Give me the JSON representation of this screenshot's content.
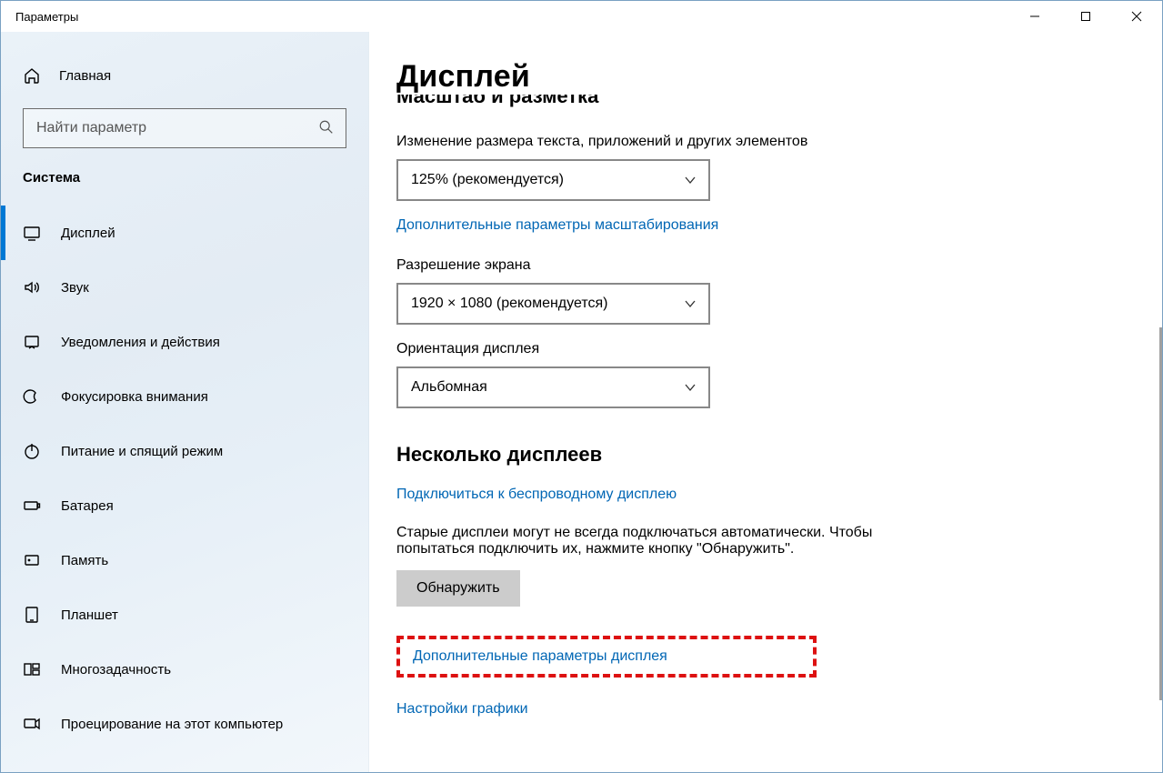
{
  "window": {
    "title": "Параметры"
  },
  "sidebar": {
    "home": "Главная",
    "search_placeholder": "Найти параметр",
    "category": "Система",
    "items": [
      {
        "label": "Дисплей",
        "active": true
      },
      {
        "label": "Звук",
        "active": false
      },
      {
        "label": "Уведомления и действия",
        "active": false
      },
      {
        "label": "Фокусировка внимания",
        "active": false
      },
      {
        "label": "Питание и спящий режим",
        "active": false
      },
      {
        "label": "Батарея",
        "active": false
      },
      {
        "label": "Память",
        "active": false
      },
      {
        "label": "Планшет",
        "active": false
      },
      {
        "label": "Многозадачность",
        "active": false
      },
      {
        "label": "Проецирование на этот компьютер",
        "active": false
      }
    ]
  },
  "main": {
    "page_title": "Дисплей",
    "partial_section": "Масштаб и разметка",
    "scale": {
      "label": "Изменение размера текста, приложений и других элементов",
      "value": "125% (рекомендуется)",
      "advanced_link": "Дополнительные параметры масштабирования"
    },
    "resolution": {
      "label": "Разрешение экрана",
      "value": "1920 × 1080 (рекомендуется)"
    },
    "orientation": {
      "label": "Ориентация дисплея",
      "value": "Альбомная"
    },
    "multi": {
      "heading": "Несколько дисплеев",
      "connect_link": "Подключиться к беспроводному дисплею",
      "hint": "Старые дисплеи могут не всегда подключаться автоматически. Чтобы попытаться подключить их, нажмите кнопку \"Обнаружить\".",
      "detect_btn": "Обнаружить"
    },
    "advanced_display_link": "Дополнительные параметры дисплея",
    "graphics_link": "Настройки графики"
  }
}
